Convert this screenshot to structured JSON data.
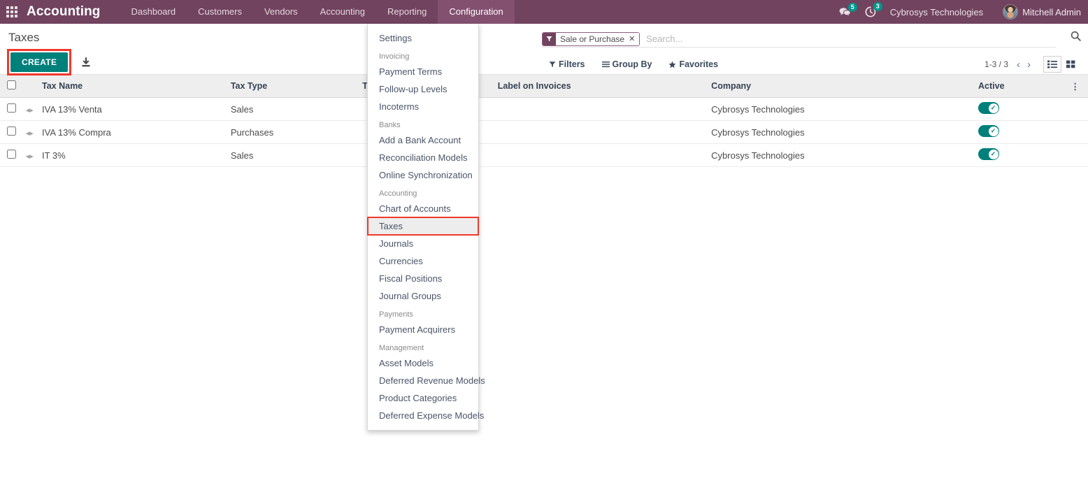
{
  "navbar": {
    "apps_icon": "apps-grid-icon",
    "brand": "Accounting",
    "menu_items": [
      {
        "label": "Dashboard",
        "active": false
      },
      {
        "label": "Customers",
        "active": false
      },
      {
        "label": "Vendors",
        "active": false
      },
      {
        "label": "Accounting",
        "active": false
      },
      {
        "label": "Reporting",
        "active": false
      },
      {
        "label": "Configuration",
        "active": true
      }
    ],
    "messages_icon": "chat-bubble-icon",
    "messages_count": "5",
    "activities_icon": "clock-icon",
    "activities_count": "3",
    "company": "Cybrosys Technologies",
    "user": "Mitchell Admin",
    "avatar_icon": "user-avatar"
  },
  "control_panel": {
    "title": "Taxes",
    "create_label": "CREATE",
    "import_icon": "import-download-icon",
    "filters_label": "Filters",
    "filters_icon": "funnel-icon",
    "groupby_label": "Group By",
    "groupby_icon": "bars-icon",
    "favorites_label": "Favorites",
    "favorites_icon": "star-icon",
    "pager": "1-3 / 3",
    "pager_prev_icon": "chevron-left-icon",
    "pager_next_icon": "chevron-right-icon",
    "view_list_icon": "list-view-icon",
    "view_kanban_icon": "kanban-view-icon",
    "search_magnifier_icon": "search-icon"
  },
  "search": {
    "facet_icon": "filter-icon",
    "facet_label": "Sale or Purchase",
    "facet_close_icon": "close-icon",
    "placeholder": "Search..."
  },
  "table": {
    "columns": [
      "Tax Name",
      "Tax Type",
      "Tax Scope",
      "Label on Invoices",
      "Company",
      "Active"
    ],
    "options_icon": "column-options-icon",
    "rows": [
      {
        "selected": false,
        "name": "IVA 13% Venta",
        "type": "Sales",
        "scope": "",
        "label_on_invoices": "",
        "company": "Cybrosys Technologies",
        "active": true
      },
      {
        "selected": false,
        "name": "IVA 13% Compra",
        "type": "Purchases",
        "scope": "",
        "label_on_invoices": "",
        "company": "Cybrosys Technologies",
        "active": true
      },
      {
        "selected": false,
        "name": "IT 3%",
        "type": "Sales",
        "scope": "",
        "label_on_invoices": "",
        "company": "Cybrosys Technologies",
        "active": true
      }
    ]
  },
  "dropdown": {
    "entries": [
      {
        "kind": "item",
        "label": "Settings"
      },
      {
        "kind": "section",
        "label": "Invoicing"
      },
      {
        "kind": "item",
        "label": "Payment Terms"
      },
      {
        "kind": "item",
        "label": "Follow-up Levels"
      },
      {
        "kind": "item",
        "label": "Incoterms"
      },
      {
        "kind": "section",
        "label": "Banks"
      },
      {
        "kind": "item",
        "label": "Add a Bank Account"
      },
      {
        "kind": "item",
        "label": "Reconciliation Models"
      },
      {
        "kind": "item",
        "label": "Online Synchronization"
      },
      {
        "kind": "section",
        "label": "Accounting"
      },
      {
        "kind": "item",
        "label": "Chart of Accounts"
      },
      {
        "kind": "item",
        "label": "Taxes",
        "highlighted": true
      },
      {
        "kind": "item",
        "label": "Journals"
      },
      {
        "kind": "item",
        "label": "Currencies"
      },
      {
        "kind": "item",
        "label": "Fiscal Positions"
      },
      {
        "kind": "item",
        "label": "Journal Groups"
      },
      {
        "kind": "section",
        "label": "Payments"
      },
      {
        "kind": "item",
        "label": "Payment Acquirers"
      },
      {
        "kind": "section",
        "label": "Management"
      },
      {
        "kind": "item",
        "label": "Asset Models"
      },
      {
        "kind": "item",
        "label": "Deferred Revenue Models"
      },
      {
        "kind": "item",
        "label": "Product Categories"
      },
      {
        "kind": "item",
        "label": "Deferred Expense Models"
      }
    ]
  },
  "colors": {
    "navbar_bg": "#71435f",
    "navbar_active": "#835070",
    "accent_teal": "#00807b",
    "badge_teal": "#00968b",
    "annotation_red": "#f0392b"
  }
}
